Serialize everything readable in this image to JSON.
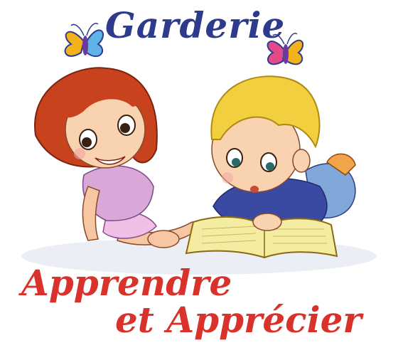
{
  "logo": {
    "title": "Garderie",
    "slogan_line1": "Apprendre",
    "slogan_line2": "et Apprécier"
  },
  "colors": {
    "title": "#2e3a8c",
    "slogan": "#d8322a",
    "girl_hair": "#c8421e",
    "boy_hair": "#f2cf3e",
    "girl_shirt": "#d9a8d8",
    "boy_shirt": "#3a4aa3",
    "book": "#f4eca0"
  },
  "icons": [
    "butterfly-icon",
    "butterfly-icon"
  ]
}
